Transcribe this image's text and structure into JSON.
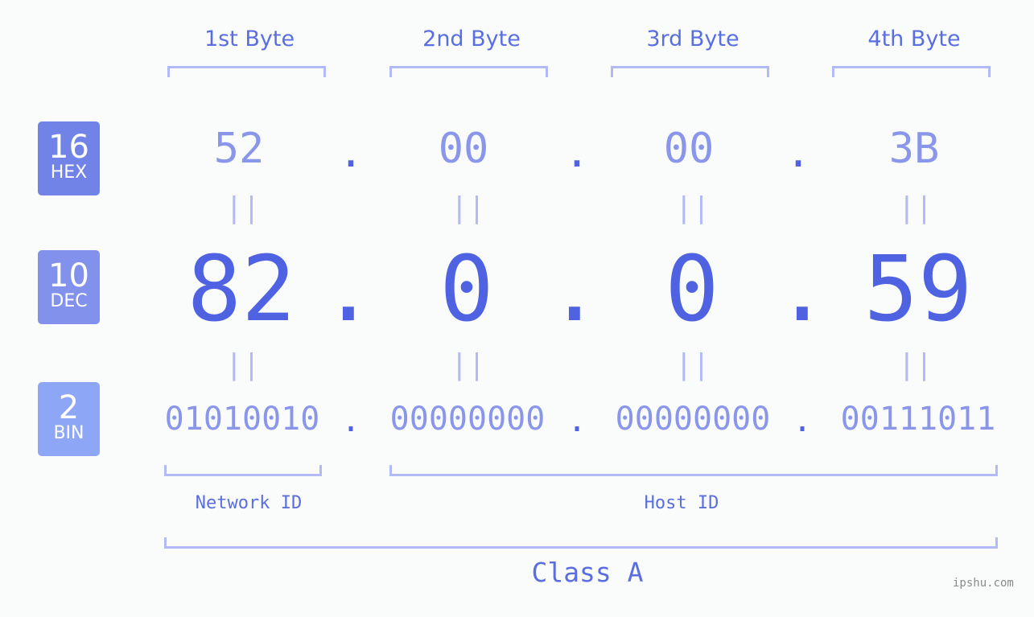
{
  "badges": [
    {
      "num": "16",
      "label": "HEX",
      "color": "#7283e8"
    },
    {
      "num": "10",
      "label": "DEC",
      "color": "#8191ec"
    },
    {
      "num": "2",
      "label": "BIN",
      "color": "#8ea6f6"
    }
  ],
  "bytes": [
    {
      "header": "1st Byte",
      "hex": "52",
      "dec": "82",
      "bin": "01010010"
    },
    {
      "header": "2nd Byte",
      "hex": "00",
      "dec": "0",
      "bin": "00000000"
    },
    {
      "header": "3rd Byte",
      "hex": "00",
      "dec": "0",
      "bin": "00000000"
    },
    {
      "header": "4th Byte",
      "hex": "3B",
      "dec": "59",
      "bin": "00111011"
    }
  ],
  "separator": ".",
  "equals": "||",
  "network_label": "Network ID",
  "host_label": "Host ID",
  "class_label": "Class A",
  "watermark": "ipshu.com",
  "colors": {
    "accent": "#4f62e2",
    "light": "#8a96ea",
    "bracket": "#b2bbf5"
  }
}
